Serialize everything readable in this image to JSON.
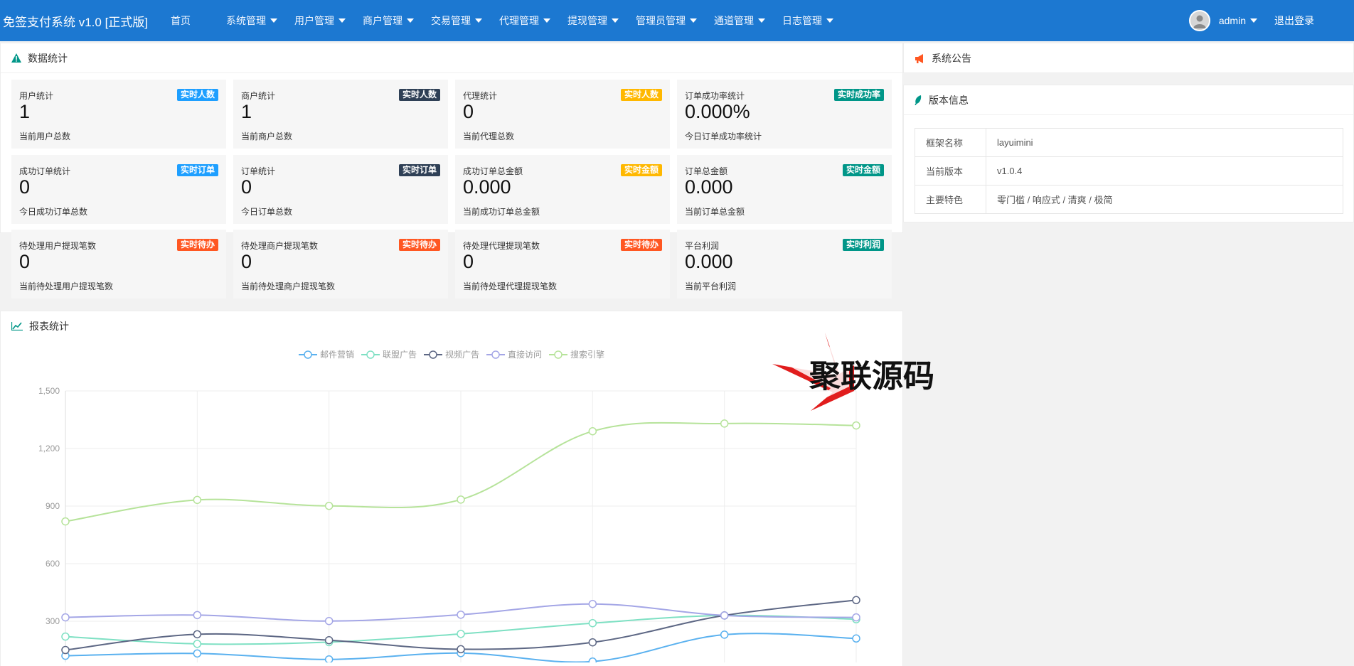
{
  "brand": "免签支付系统 v1.0 [正式版]",
  "nav": [
    {
      "label": "首页",
      "dropdown": false
    },
    {
      "label": "系统管理",
      "dropdown": true
    },
    {
      "label": "用户管理",
      "dropdown": true
    },
    {
      "label": "商户管理",
      "dropdown": true
    },
    {
      "label": "交易管理",
      "dropdown": true
    },
    {
      "label": "代理管理",
      "dropdown": true
    },
    {
      "label": "提现管理",
      "dropdown": true
    },
    {
      "label": "管理员管理",
      "dropdown": true
    },
    {
      "label": "通道管理",
      "dropdown": true
    },
    {
      "label": "日志管理",
      "dropdown": true
    }
  ],
  "user": {
    "name": "admin",
    "logout": "退出登录"
  },
  "stats_panel": {
    "title": "数据统计"
  },
  "stats": [
    {
      "title": "用户统计",
      "badge": "实时人数",
      "badge_color": "#1e9fff",
      "value": "1",
      "sub": "当前用户总数"
    },
    {
      "title": "商户统计",
      "badge": "实时人数",
      "badge_color": "#2f4056",
      "value": "1",
      "sub": "当前商户总数"
    },
    {
      "title": "代理统计",
      "badge": "实时人数",
      "badge_color": "#ffb800",
      "value": "0",
      "sub": "当前代理总数"
    },
    {
      "title": "订单成功率统计",
      "badge": "实时成功率",
      "badge_color": "#009688",
      "value": "0.000%",
      "sub": "今日订单成功率统计"
    },
    {
      "title": "成功订单统计",
      "badge": "实时订单",
      "badge_color": "#1e9fff",
      "value": "0",
      "sub": "今日成功订单总数"
    },
    {
      "title": "订单统计",
      "badge": "实时订单",
      "badge_color": "#2f4056",
      "value": "0",
      "sub": "今日订单总数"
    },
    {
      "title": "成功订单总金额",
      "badge": "实时金额",
      "badge_color": "#ffb800",
      "value": "0.000",
      "sub": "当前成功订单总金额"
    },
    {
      "title": "订单总金额",
      "badge": "实时金额",
      "badge_color": "#009688",
      "value": "0.000",
      "sub": "当前订单总金额"
    },
    {
      "title": "待处理用户提现笔数",
      "badge": "实时待办",
      "badge_color": "#ff5722",
      "value": "0",
      "sub": "当前待处理用户提现笔数"
    },
    {
      "title": "待处理商户提现笔数",
      "badge": "实时待办",
      "badge_color": "#ff5722",
      "value": "0",
      "sub": "当前待处理商户提现笔数"
    },
    {
      "title": "待处理代理提现笔数",
      "badge": "实时待办",
      "badge_color": "#ff5722",
      "value": "0",
      "sub": "当前待处理代理提现笔数"
    },
    {
      "title": "平台利润",
      "badge": "实时利润",
      "badge_color": "#009688",
      "value": "0.000",
      "sub": "当前平台利润"
    }
  ],
  "notice_panel": {
    "title": "系统公告"
  },
  "version_panel": {
    "title": "版本信息",
    "rows": [
      {
        "key": "框架名称",
        "value": "layuimini"
      },
      {
        "key": "当前版本",
        "value": "v1.0.4"
      },
      {
        "key": "主要特色",
        "value": "零门槛 / 响应式 / 清爽 / 极简"
      }
    ]
  },
  "report_panel": {
    "title": "报表统计"
  },
  "watermark": {
    "text": "聚联源码"
  },
  "chart_data": {
    "type": "line",
    "title": "",
    "xlabel": "",
    "ylabel": "",
    "ylim": [
      0,
      1500
    ],
    "yticks": [
      300,
      600,
      900,
      1200,
      1500
    ],
    "ytick_labels": [
      "300",
      "600",
      "900",
      "1,200",
      "1,500"
    ],
    "categories": [
      "",
      "",
      "",
      "",
      "",
      "",
      ""
    ],
    "grid": true,
    "legend_position": "top-center",
    "smooth": true,
    "series": [
      {
        "name": "邮件营销",
        "color": "#5ab1ef",
        "values": [
          120,
          132,
          101,
          134,
          90,
          230,
          210
        ]
      },
      {
        "name": "联盟广告",
        "color": "#7ee0c3",
        "values": [
          220,
          182,
          191,
          234,
          290,
          330,
          310
        ]
      },
      {
        "name": "视频广告",
        "color": "#5d6784",
        "values": [
          150,
          232,
          201,
          154,
          190,
          330,
          410
        ]
      },
      {
        "name": "直接访问",
        "color": "#a4a6e6",
        "values": [
          320,
          332,
          301,
          334,
          390,
          330,
          320
        ]
      },
      {
        "name": "搜索引擎",
        "color": "#b6e39a",
        "values": [
          820,
          932,
          901,
          934,
          1290,
          1330,
          1320
        ]
      }
    ]
  }
}
